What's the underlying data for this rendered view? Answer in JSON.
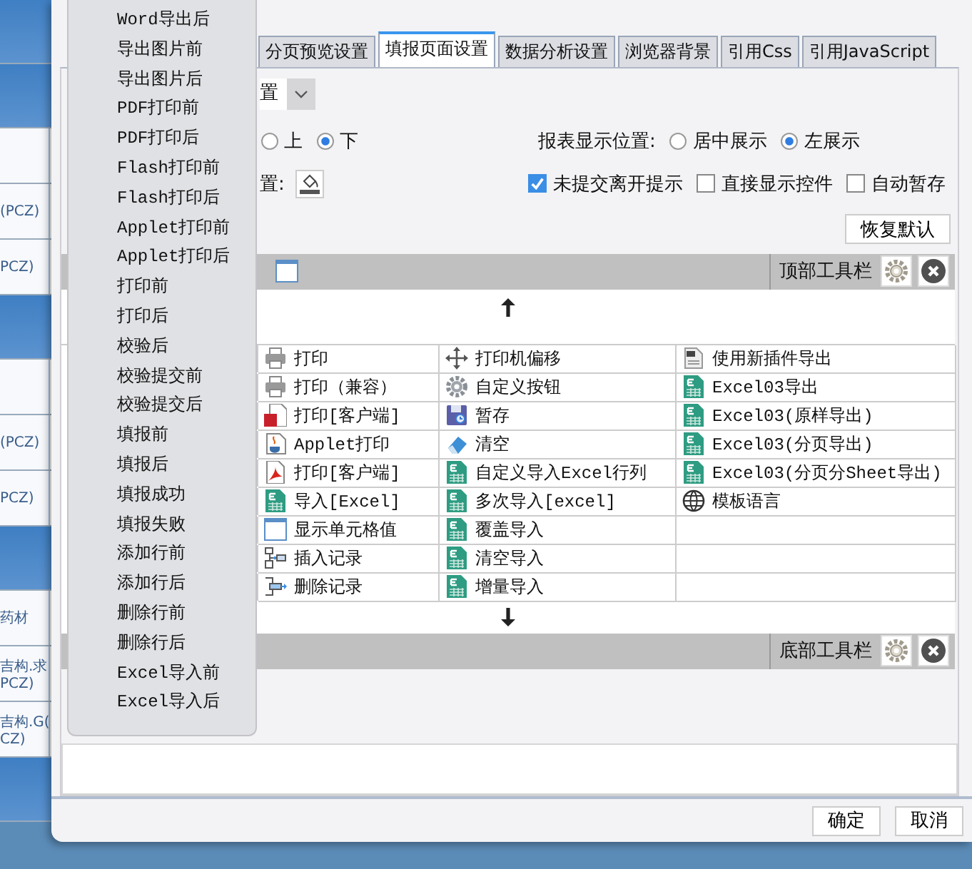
{
  "background_sheet": {
    "rows": [
      {
        "kind": "band"
      },
      {
        "kind": "band"
      },
      {
        "kind": "cell",
        "lines": []
      },
      {
        "kind": "cell",
        "lines": [
          "(PCZ)"
        ]
      },
      {
        "kind": "cell",
        "lines": [
          "PCZ)"
        ]
      },
      {
        "kind": "band"
      },
      {
        "kind": "cell",
        "lines": []
      },
      {
        "kind": "cell",
        "lines": [
          "(PCZ)"
        ]
      },
      {
        "kind": "cell",
        "lines": [
          "PCZ)"
        ]
      },
      {
        "kind": "band"
      },
      {
        "kind": "cell",
        "lines": [
          "药材"
        ]
      },
      {
        "kind": "cell",
        "lines": [
          "吉构.求",
          "PCZ)"
        ]
      },
      {
        "kind": "cell",
        "lines": [
          "吉构.G(",
          "CZ)"
        ]
      },
      {
        "kind": "band"
      }
    ]
  },
  "tabs": [
    {
      "label": "分页预览设置",
      "selected": false
    },
    {
      "label": "填报页面设置",
      "selected": true
    },
    {
      "label": "数据分析设置",
      "selected": false
    },
    {
      "label": "浏览器背景",
      "selected": false
    },
    {
      "label": "引用Css",
      "selected": false
    },
    {
      "label": "引用JavaScript",
      "selected": false
    }
  ],
  "mode_select": {
    "value": "置"
  },
  "toolbar_position_options": [
    {
      "label": "上",
      "selected": false
    },
    {
      "label": "下",
      "selected": true
    }
  ],
  "report_position": {
    "label": "报表显示位置:",
    "options": [
      {
        "label": "居中展示",
        "selected": false
      },
      {
        "label": "左展示",
        "selected": true
      }
    ]
  },
  "background_setting": {
    "label": "置:"
  },
  "options": [
    {
      "label": "未提交离开提示",
      "checked": true
    },
    {
      "label": "直接显示控件",
      "checked": false
    },
    {
      "label": "自动暂存",
      "checked": false
    }
  ],
  "reset_button": "恢复默认",
  "top_toolbar": {
    "label": "顶部工具栏"
  },
  "button_grid": {
    "columns": [
      [
        {
          "kind": "printer",
          "label": "打印"
        },
        {
          "kind": "printer",
          "label": "打印（兼容）"
        },
        {
          "kind": "flash",
          "label": "打印[客户端]"
        },
        {
          "kind": "applet",
          "label": "Applet打印"
        },
        {
          "kind": "pdf",
          "label": "打印[客户端]"
        },
        {
          "kind": "excel",
          "label": "导入[Excel]"
        },
        {
          "kind": "cell",
          "label": "显示单元格值"
        },
        {
          "kind": "insert",
          "label": "插入记录"
        },
        {
          "kind": "delete",
          "label": "删除记录"
        }
      ],
      [
        {
          "kind": "move",
          "label": "打印机偏移"
        },
        {
          "kind": "gear",
          "label": "自定义按钮"
        },
        {
          "kind": "save",
          "label": "暂存"
        },
        {
          "kind": "eraser",
          "label": "清空"
        },
        {
          "kind": "excel",
          "label": "自定义导入Excel行列"
        },
        {
          "kind": "excel",
          "label": "多次导入[excel]"
        },
        {
          "kind": "excel",
          "label": "覆盖导入"
        },
        {
          "kind": "excel",
          "label": "清空导入"
        },
        {
          "kind": "excel",
          "label": "增量导入"
        }
      ],
      [
        {
          "kind": "word",
          "label": "使用新插件导出"
        },
        {
          "kind": "excel",
          "label": "Excel03导出"
        },
        {
          "kind": "excel",
          "label": "Excel03(原样导出)"
        },
        {
          "kind": "excel",
          "label": "Excel03(分页导出)"
        },
        {
          "kind": "excel",
          "label": "Excel03(分页分Sheet导出)"
        },
        {
          "kind": "globe",
          "label": "模板语言"
        }
      ]
    ]
  },
  "bottom_toolbar": {
    "label": "底部工具栏"
  },
  "dialog_buttons": [
    "确定",
    "取消"
  ],
  "event_menu": {
    "items": [
      "Word导出后",
      "导出图片前",
      "导出图片后",
      "PDF打印前",
      "PDF打印后",
      "Flash打印前",
      "Flash打印后",
      "Applet打印前",
      "Applet打印后",
      "打印前",
      "打印后",
      "校验后",
      "校验提交前",
      "校验提交后",
      "填报前",
      "填报后",
      "填报成功",
      "填报失败",
      "添加行前",
      "添加行后",
      "删除行前",
      "删除行后",
      "Excel导入前",
      "Excel导入后"
    ]
  }
}
